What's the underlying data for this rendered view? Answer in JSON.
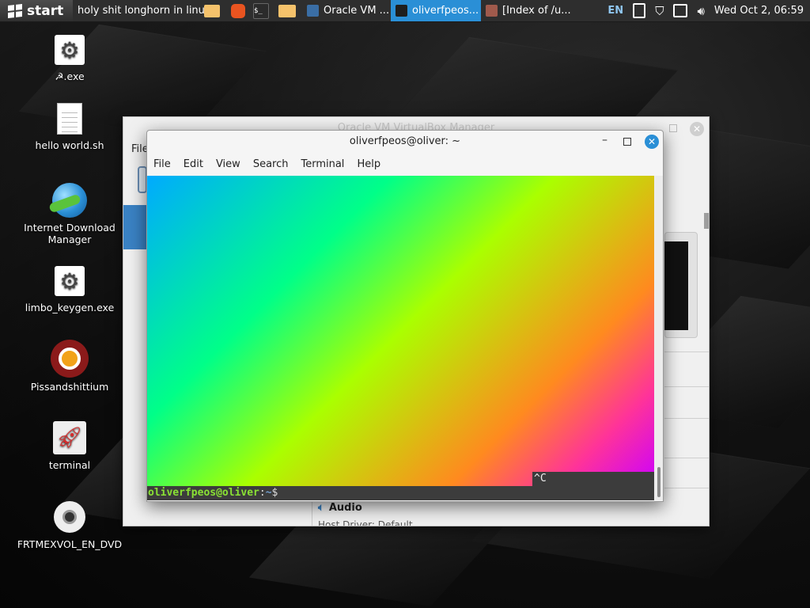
{
  "taskbar": {
    "start_label": "start",
    "items": [
      {
        "label": "holy shit longhorn in linux",
        "icon": "folder-icon",
        "color": "#f5c26b"
      },
      {
        "label": "",
        "icon": "ubuntu-app-icon",
        "color": "#e95420"
      },
      {
        "label": "",
        "icon": "terminal-app-icon",
        "color": "#2b2b2b"
      },
      {
        "label": "",
        "icon": "files-icon",
        "color": "#f5c26b"
      },
      {
        "label": "Oracle VM ...",
        "icon": "virtualbox-icon",
        "color": "#3a6ea5"
      },
      {
        "label": "oliverfpeos...",
        "icon": "terminal-window-icon",
        "color": "#1e1e1e",
        "active": true
      },
      {
        "label": "[Index of /u...",
        "icon": "browser-icon",
        "color": "#a05a4c"
      }
    ],
    "tray": {
      "language": "EN",
      "datetime": "Wed Oct  2, 06:59"
    },
    "accent": "#2a8fd6"
  },
  "desktop_icons": [
    {
      "label": "☭.exe",
      "icon": "gear-icon"
    },
    {
      "label": "hello world.sh",
      "icon": "text-file-icon"
    },
    {
      "label": "Internet Download Manager",
      "icon": "idm-globe-icon"
    },
    {
      "label": "limbo_keygen.exe",
      "icon": "gear-icon"
    },
    {
      "label": "Pissandshittium",
      "icon": "chromium-icon"
    },
    {
      "label": "terminal",
      "icon": "rocket-icon"
    },
    {
      "label": "FRTMEXVOL_EN_DVD",
      "icon": "dvd-disc-icon"
    }
  ],
  "vbox_window": {
    "title": "Oracle VM VirtualBox Manager",
    "menu_partial": "File",
    "audio_label": "Audio",
    "host_driver_partial": "Host Driver: Default"
  },
  "terminal": {
    "title": "oliverfpeos@oliver: ~",
    "menu": [
      "File",
      "Edit",
      "View",
      "Search",
      "Terminal",
      "Help"
    ],
    "ctrl_c": "^C",
    "prompt_user": "oliverfpeos@oliver",
    "prompt_colon": ":",
    "prompt_path": "~",
    "prompt_symbol": "$"
  }
}
